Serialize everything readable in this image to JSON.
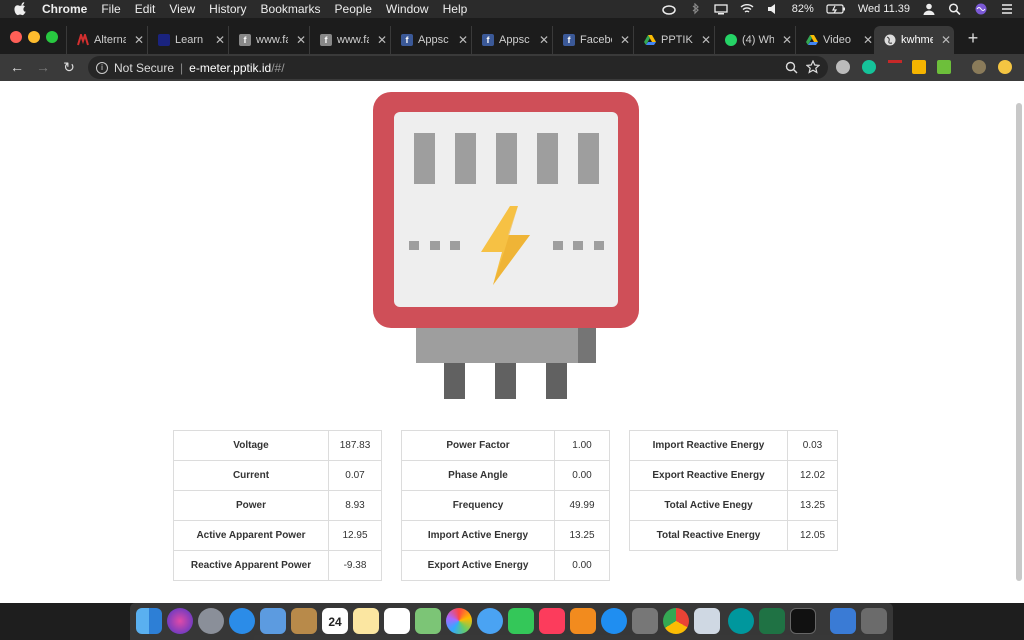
{
  "menubar": {
    "app": "Chrome",
    "items": [
      "File",
      "Edit",
      "View",
      "History",
      "Bookmarks",
      "People",
      "Window",
      "Help"
    ],
    "battery": "82%",
    "clock": "Wed 11.39"
  },
  "tabs": [
    {
      "title": "Alterna",
      "icon": "alternatif-icon",
      "color": "#d32f2f"
    },
    {
      "title": "Learn |",
      "icon": "learn-icon",
      "color": "#1a237e"
    },
    {
      "title": "www.fa",
      "icon": "generic-facebook-icon",
      "color": "#888888"
    },
    {
      "title": "www.fa",
      "icon": "generic-facebook-icon",
      "color": "#888888"
    },
    {
      "title": "Appsc",
      "icon": "facebook-icon",
      "color": "#3b5998"
    },
    {
      "title": "Appsc",
      "icon": "facebook-icon",
      "color": "#3b5998"
    },
    {
      "title": "Facebo",
      "icon": "facebook-icon",
      "color": "#3b5998"
    },
    {
      "title": "PPTIK",
      "icon": "google-drive-icon",
      "color": "#fbbc04"
    },
    {
      "title": "(4) Wh",
      "icon": "whatsapp-icon",
      "color": "#25d366"
    },
    {
      "title": "Video",
      "icon": "google-drive-icon",
      "color": "#34a853"
    },
    {
      "title": "kwhme",
      "icon": "globe-icon",
      "color": "#dddddd",
      "active": true
    }
  ],
  "toolbar": {
    "security": "Not Secure",
    "url_host": "e-meter.pptik.id",
    "url_path": "/#/"
  },
  "tables": [
    {
      "rows": [
        {
          "label": "Voltage",
          "value": "187.83"
        },
        {
          "label": "Current",
          "value": "0.07"
        },
        {
          "label": "Power",
          "value": "8.93"
        },
        {
          "label": "Active Apparent Power",
          "value": "12.95"
        },
        {
          "label": "Reactive Apparent Power",
          "value": "-9.38"
        }
      ]
    },
    {
      "rows": [
        {
          "label": "Power Factor",
          "value": "1.00"
        },
        {
          "label": "Phase Angle",
          "value": "0.00"
        },
        {
          "label": "Frequency",
          "value": "49.99"
        },
        {
          "label": "Import Active Energy",
          "value": "13.25"
        },
        {
          "label": "Export Active Energy",
          "value": "0.00"
        }
      ]
    },
    {
      "rows": [
        {
          "label": "Import Reactive Energy",
          "value": "0.03"
        },
        {
          "label": "Export Reactive Energy",
          "value": "12.02"
        },
        {
          "label": "Total Active Enegy",
          "value": "13.25"
        },
        {
          "label": "Total Reactive Energy",
          "value": "12.05"
        }
      ]
    }
  ],
  "dock": {
    "calendar_day": "24",
    "apps": [
      "finder-icon",
      "siri-icon",
      "launchpad-icon",
      "safari-icon",
      "mail-icon",
      "contacts-icon",
      "calendar-icon",
      "notes-icon",
      "reminders-icon",
      "maps-icon",
      "photos-icon",
      "messages-icon",
      "facetime-icon",
      "music-icon",
      "books-icon",
      "app-store-icon",
      "system-preferences-icon",
      "chrome-icon",
      "preview-icon",
      "arduino-icon",
      "excel-icon",
      "terminal-icon",
      "downloads-icon",
      "trash-icon"
    ]
  },
  "colors": {
    "meter_frame": "#cf4f58",
    "meter_screen": "#eeeeee",
    "bolt": "#f6c144"
  }
}
